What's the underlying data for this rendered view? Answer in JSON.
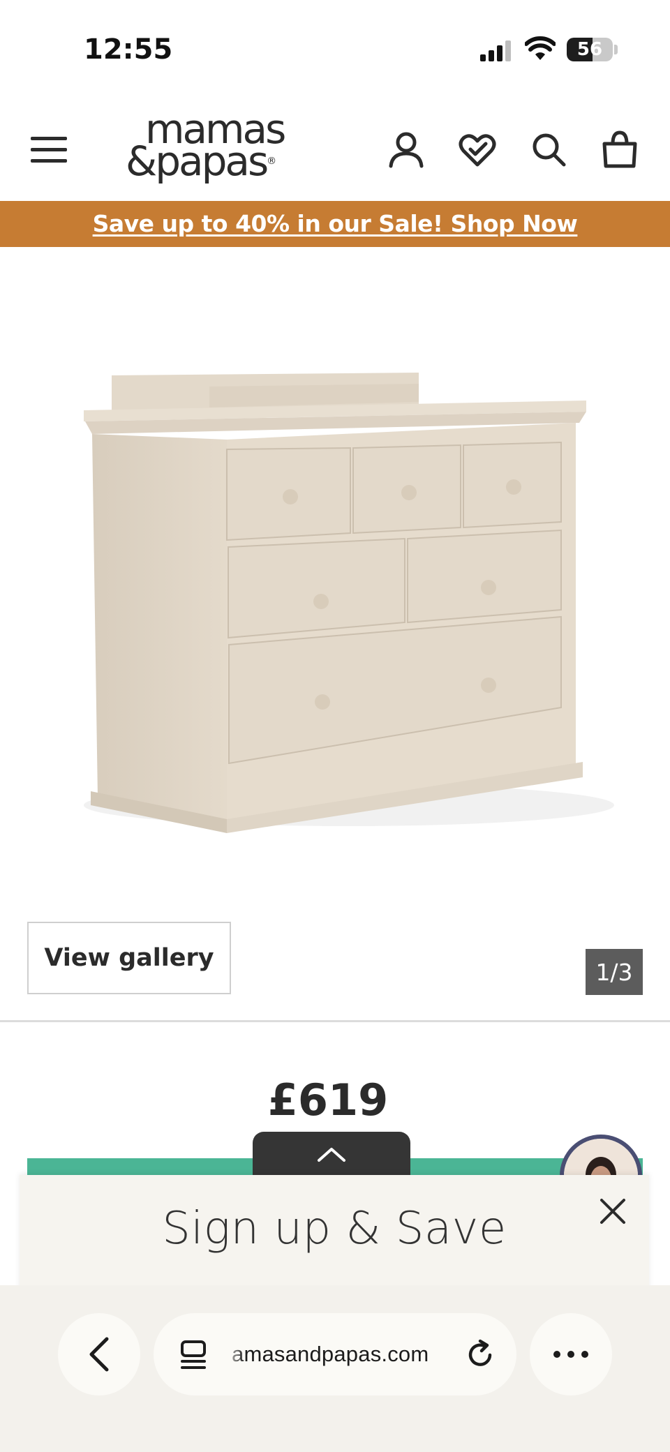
{
  "status_bar": {
    "time": "12:55",
    "battery_percent": "56",
    "battery_level": 0.56
  },
  "header": {
    "logo_line1": "mamas",
    "logo_line2": "&papas",
    "logo_mark": "®",
    "icons": [
      "hamburger-menu-icon",
      "account-icon",
      "wishlist-heart-icon",
      "search-icon",
      "shopping-bag-icon"
    ]
  },
  "promo": {
    "text": "Save up to 40% in our Sale! Shop Now",
    "background_color": "#c67c33"
  },
  "gallery": {
    "view_gallery_label": "View gallery",
    "counter": "1/3",
    "product_color": "#e6dccd"
  },
  "product": {
    "price": "£619",
    "cta_color": "#4bb595"
  },
  "signup": {
    "title": "Sign up & Save"
  },
  "browser": {
    "url": "amasandpapas.com",
    "icons": [
      "back-chevron-icon",
      "tabs-icon",
      "reload-icon",
      "more-icon"
    ]
  }
}
